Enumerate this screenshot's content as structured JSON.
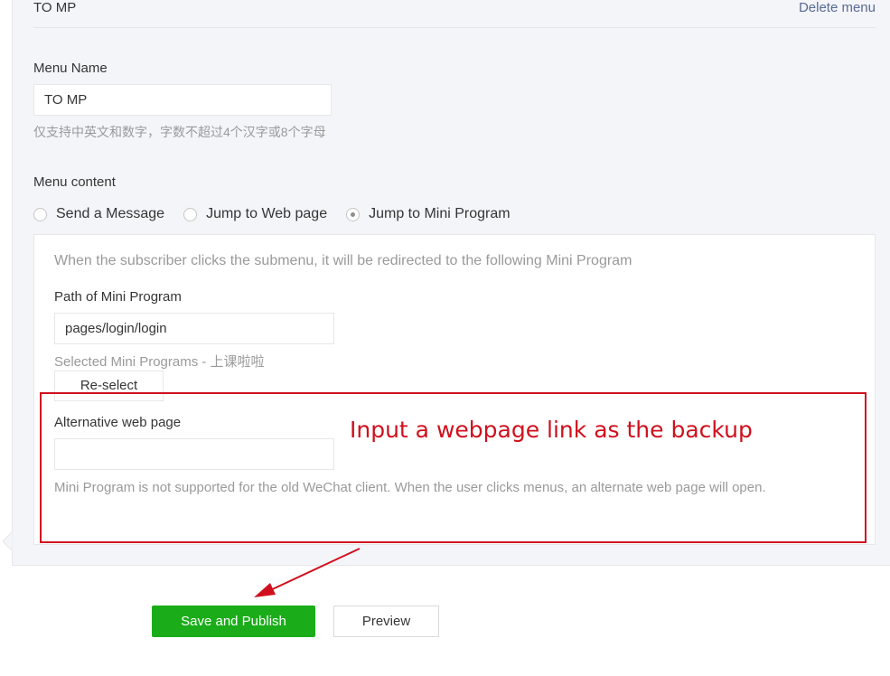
{
  "header": {
    "title": "TO MP",
    "delete_label": "Delete menu"
  },
  "menu_name": {
    "label": "Menu Name",
    "value": "TO MP",
    "hint": "仅支持中英文和数字，字数不超过4个汉字或8个字母"
  },
  "menu_content": {
    "label": "Menu content",
    "options": [
      {
        "label": "Send a Message",
        "checked": false
      },
      {
        "label": "Jump to Web page",
        "checked": false
      },
      {
        "label": "Jump to Mini Program",
        "checked": true
      }
    ]
  },
  "mini_program": {
    "description": "When the subscriber clicks the submenu, it will be redirected to the following Mini Program",
    "path_label": "Path of Mini Program",
    "path_value": "pages/login/login",
    "selected_text": "Selected Mini Programs - 上课啦啦",
    "reselect_label": "Re-select",
    "alt_label": "Alternative web page",
    "alt_value": "",
    "alt_hint": "Mini Program is not supported for the old WeChat client. When the user clicks menus, an alternate web page will open."
  },
  "annotation": {
    "text": "Input a webpage link as the backup",
    "color": "#d0101d"
  },
  "footer": {
    "save_label": "Save and Publish",
    "preview_label": "Preview"
  },
  "colors": {
    "primary": "#1aad19",
    "link": "#576b95",
    "hint": "#9a9a9a"
  }
}
